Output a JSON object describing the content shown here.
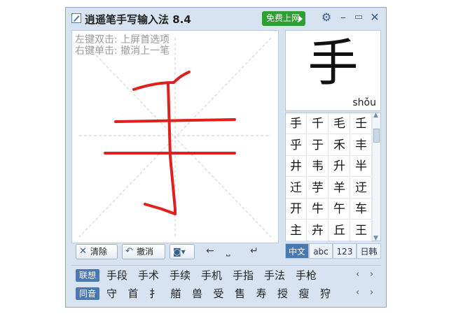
{
  "window": {
    "title": "逍遥笔手写输入法 8.4",
    "free_button": "免费上网"
  },
  "canvas": {
    "hint_line1": "左键双击: 上屏首选项",
    "hint_line2": "右键单击: 撤消上一笔",
    "stroke_color": "#e0201c"
  },
  "toolbar": {
    "clear_label": "清除",
    "undo_label": "撤消"
  },
  "preview": {
    "char": "手",
    "pinyin": "shǒu"
  },
  "candidates": [
    "手",
    "千",
    "毛",
    "壬",
    "乎",
    "于",
    "禾",
    "丰",
    "井",
    "韦",
    "升",
    "半",
    "迁",
    "芋",
    "羊",
    "迂",
    "开",
    "牛",
    "午",
    "车",
    "主",
    "卉",
    "丘",
    "王"
  ],
  "modes": [
    {
      "label": "中文",
      "active": true
    },
    {
      "label": "abc",
      "active": false
    },
    {
      "label": "123",
      "active": false
    },
    {
      "label": "日韩",
      "active": false
    }
  ],
  "assoc": {
    "label": "联想",
    "words": [
      "手段",
      "手术",
      "手续",
      "手机",
      "手指",
      "手法",
      "手枪"
    ]
  },
  "homo": {
    "label": "同音",
    "words": [
      "守",
      "首",
      "扌",
      "艏",
      "兽",
      "受",
      "售",
      "寿",
      "授",
      "瘦",
      "狩"
    ]
  },
  "colors": {
    "accent": "#4a78b0",
    "free_green": "#2f9e33"
  }
}
